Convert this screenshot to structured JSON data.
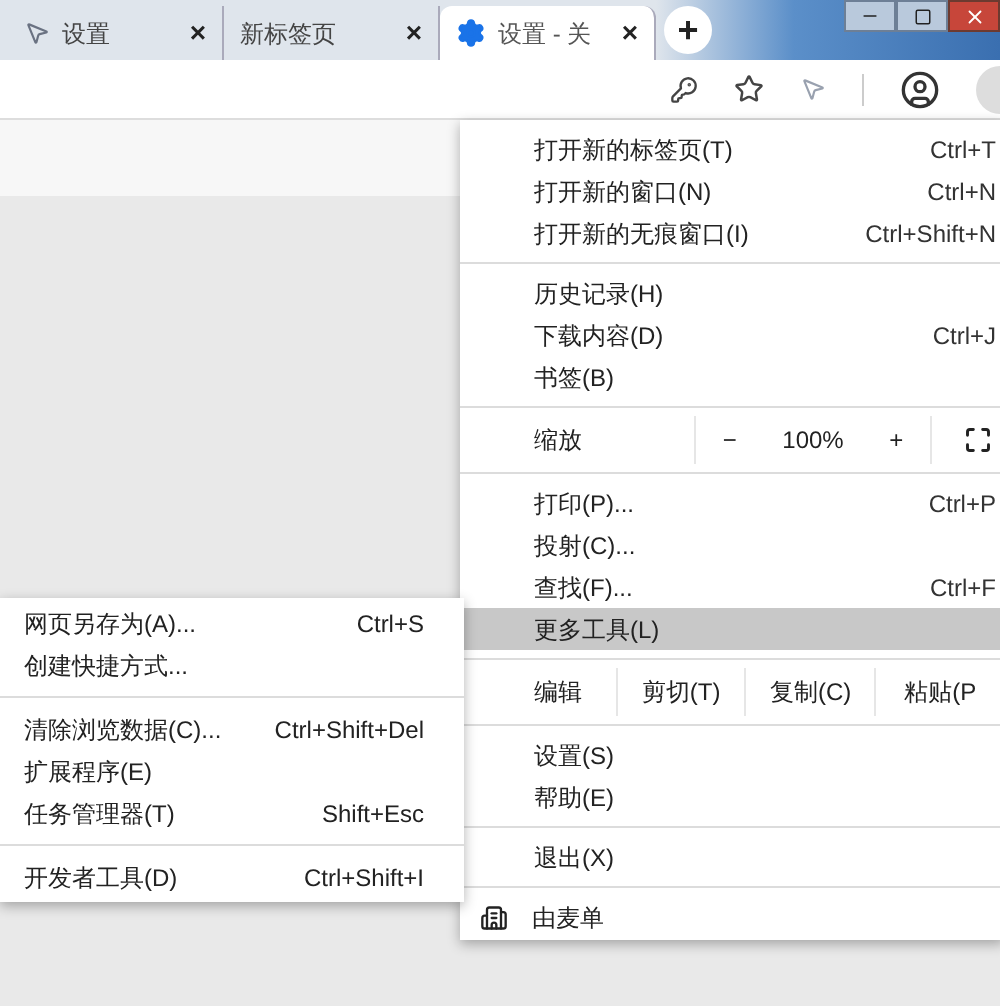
{
  "tabs": [
    {
      "title": "设置",
      "selected": false,
      "close": "×"
    },
    {
      "title": "新标签页",
      "selected": false,
      "close": "×"
    },
    {
      "title": "设置 - 关",
      "selected": true,
      "close": "×"
    }
  ],
  "new_tab": "+",
  "main_menu": [
    {
      "kind": "item",
      "label": "打开新的标签页(T)",
      "shortcut": "Ctrl+T",
      "selected": false
    },
    {
      "kind": "item",
      "label": "打开新的窗口(N)",
      "shortcut": "Ctrl+N",
      "selected": false
    },
    {
      "kind": "item",
      "label": "打开新的无痕窗口(I)",
      "shortcut": "Ctrl+Shift+N",
      "selected": false
    },
    {
      "kind": "separator"
    },
    {
      "kind": "item",
      "label": "历史记录(H)",
      "selected": false
    },
    {
      "kind": "item",
      "label": "下载内容(D)",
      "shortcut": "Ctrl+J",
      "selected": false
    },
    {
      "kind": "item",
      "label": "书签(B)",
      "selected": false
    },
    {
      "kind": "separator"
    },
    {
      "kind": "zoom",
      "label": "缩放",
      "minus": "−",
      "value": "100%",
      "plus": "+"
    },
    {
      "kind": "separator"
    },
    {
      "kind": "item",
      "label": "打印(P)...",
      "shortcut": "Ctrl+P",
      "selected": false
    },
    {
      "kind": "item",
      "label": "投射(C)...",
      "selected": false
    },
    {
      "kind": "item",
      "label": "查找(F)...",
      "shortcut": "Ctrl+F",
      "selected": false
    },
    {
      "kind": "item",
      "label": "更多工具(L)",
      "selected": true
    },
    {
      "kind": "separator"
    },
    {
      "kind": "edit",
      "label": "编辑",
      "buttons": [
        "剪切(T)",
        "复制(C)",
        "粘贴(P"
      ]
    },
    {
      "kind": "separator"
    },
    {
      "kind": "item",
      "label": "设置(S)",
      "selected": false
    },
    {
      "kind": "item",
      "label": "帮助(E)",
      "selected": false
    },
    {
      "kind": "separator"
    },
    {
      "kind": "item",
      "label": "退出(X)",
      "selected": false
    },
    {
      "kind": "separator"
    },
    {
      "kind": "managed",
      "label": "由麦单"
    }
  ],
  "submenu": [
    {
      "kind": "item",
      "label": "网页另存为(A)...",
      "shortcut": "Ctrl+S"
    },
    {
      "kind": "item",
      "label": "创建快捷方式..."
    },
    {
      "kind": "separator"
    },
    {
      "kind": "item",
      "label": "清除浏览数据(C)...",
      "shortcut": "Ctrl+Shift+Del"
    },
    {
      "kind": "item",
      "label": "扩展程序(E)"
    },
    {
      "kind": "item",
      "label": "任务管理器(T)",
      "shortcut": "Shift+Esc"
    },
    {
      "kind": "separator"
    },
    {
      "kind": "item",
      "label": "开发者工具(D)",
      "shortcut": "Ctrl+Shift+I"
    }
  ]
}
